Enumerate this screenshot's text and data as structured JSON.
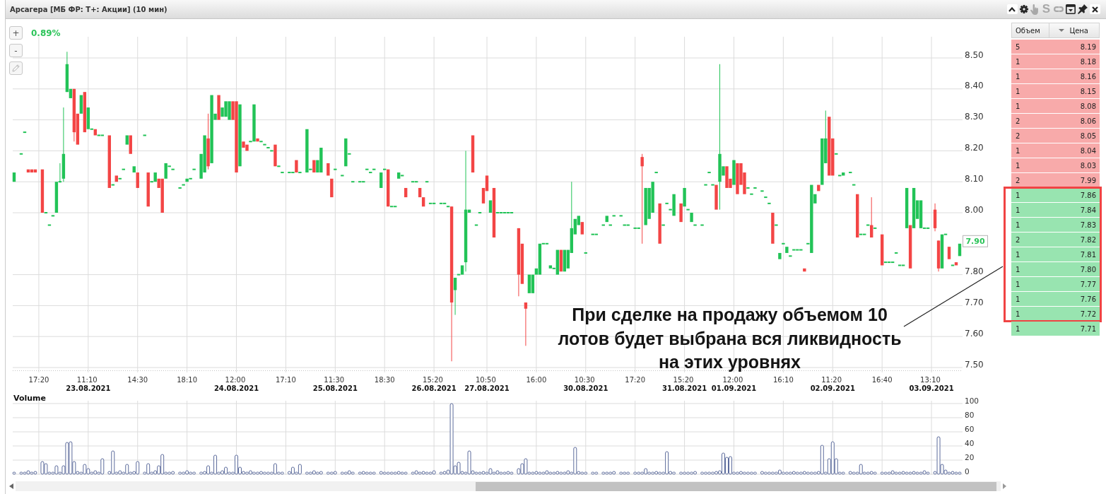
{
  "window": {
    "title": "Арсагера [МБ ФР: Т+: Акции] (10 мин)",
    "controls": [
      {
        "kind": "collapse",
        "disabled": false
      },
      {
        "kind": "settings",
        "disabled": false
      },
      {
        "kind": "hand",
        "disabled": true
      },
      {
        "kind": "letter",
        "label": "S",
        "disabled": true
      },
      {
        "kind": "link",
        "disabled": true
      },
      {
        "kind": "window",
        "disabled": false
      },
      {
        "kind": "pin",
        "disabled": false
      },
      {
        "kind": "close",
        "disabled": false
      }
    ]
  },
  "chart": {
    "tools": [
      {
        "kind": "zoom_in",
        "label": "+",
        "disabled": false
      },
      {
        "kind": "zoom_out",
        "label": "-",
        "disabled": false
      },
      {
        "kind": "pencil",
        "disabled": true
      }
    ],
    "change": "0.89%",
    "last_price": "7.90",
    "chart_data": {
      "type": "candlestick",
      "grid": true,
      "ylim": [
        7.5,
        8.5
      ],
      "yticks": [
        {
          "value": 8.5,
          "label": "8.50"
        },
        {
          "value": 8.4,
          "label": "8.40"
        },
        {
          "value": 8.3,
          "label": "8.30"
        },
        {
          "value": 8.2,
          "label": "8.20"
        },
        {
          "value": 8.1,
          "label": "8.10"
        },
        {
          "value": 8.0,
          "label": "8.00"
        },
        {
          "value": 7.8,
          "label": "7.80"
        },
        {
          "value": 7.7,
          "label": "7.70"
        },
        {
          "value": 7.6,
          "label": "7.60"
        },
        {
          "value": 7.5,
          "label": "7.50"
        }
      ],
      "categories": [
        null,
        null,
        null,
        null,
        null,
        null,
        null,
        "17:20",
        null,
        null,
        null,
        null,
        null,
        null,
        null,
        null,
        null,
        null,
        null,
        null,
        null,
        "11:10\n23.08.2021",
        null,
        null,
        null,
        null,
        null,
        null,
        null,
        null,
        null,
        null,
        null,
        null,
        null,
        "14:30",
        null,
        null,
        null,
        null,
        null,
        null,
        null,
        null,
        null,
        null,
        null,
        null,
        null,
        "18:10",
        null,
        null,
        null,
        null,
        null,
        null,
        null,
        null,
        null,
        null,
        null,
        null,
        null,
        "12:00\n24.08.2021",
        null,
        null,
        null,
        null,
        null,
        null,
        null,
        null,
        null,
        null,
        null,
        null,
        null,
        "17:10",
        null,
        null,
        null,
        null,
        null,
        null,
        null,
        null,
        null,
        null,
        null,
        null,
        null,
        "11:30\n25.08.2021",
        null,
        null,
        null,
        null,
        null,
        null,
        null,
        null,
        null,
        null,
        null,
        null,
        null,
        "18:30",
        null,
        null,
        null,
        null,
        null,
        null,
        null,
        null,
        null,
        null,
        null,
        null,
        null,
        "15:20\n26.08.2021",
        null,
        null,
        null,
        null,
        null,
        null,
        null,
        null,
        null,
        null,
        null,
        null,
        null,
        null,
        "10:50\n27.08.2021",
        null,
        null,
        null,
        null,
        null,
        null,
        null,
        null,
        null,
        null,
        null,
        null,
        null,
        "16:00",
        null,
        null,
        null,
        null,
        null,
        null,
        null,
        null,
        null,
        null,
        null,
        null,
        null,
        "10:30\n30.08.2021",
        null,
        null,
        null,
        null,
        null,
        null,
        null,
        null,
        null,
        null,
        null,
        null,
        null,
        "17:20",
        null,
        null,
        null,
        null,
        null,
        null,
        null,
        null,
        null,
        null,
        null,
        null,
        null,
        "15:20\n31.08.2021",
        null,
        null,
        null,
        null,
        null,
        null,
        null,
        null,
        null,
        null,
        null,
        null,
        null,
        "12:00\n01.09.2021",
        null,
        null,
        null,
        null,
        null,
        null,
        null,
        null,
        null,
        null,
        null,
        null,
        null,
        "16:10",
        null,
        null,
        null,
        null,
        null,
        null,
        null,
        null,
        null,
        null,
        null,
        null,
        null,
        "11:20\n02.09.2021",
        null,
        null,
        null,
        null,
        null,
        null,
        null,
        null,
        null,
        null,
        null,
        null,
        null,
        "16:40",
        null,
        null,
        null,
        null,
        null,
        null,
        null,
        null,
        null,
        null,
        null,
        null,
        null,
        "13:10\n03.09.2021",
        null,
        null,
        null,
        null,
        null,
        null,
        null,
        null
      ],
      "ohlc": [
        [
          8.1,
          8.13,
          8.1,
          8.13
        ],
        null,
        [
          8.19,
          8.19,
          8.19,
          8.19
        ],
        [
          8.26,
          8.26,
          8.26,
          8.26
        ],
        [
          8.14,
          8.14,
          8.13,
          8.13
        ],
        [
          8.14,
          8.14,
          8.13,
          8.13
        ],
        [
          8.14,
          8.14,
          8.13,
          8.13
        ],
        null,
        [
          8.14,
          8.14,
          8.0,
          8.0
        ],
        [
          8.0,
          8.0,
          8.0,
          8.0
        ],
        [
          7.96,
          7.96,
          7.96,
          7.96
        ],
        [
          7.99,
          7.99,
          7.99,
          7.99
        ],
        [
          8.0,
          8.1,
          8.0,
          8.1
        ],
        [
          8.1,
          8.16,
          8.1,
          8.1
        ],
        [
          8.11,
          8.34,
          8.1,
          8.19
        ],
        [
          8.39,
          8.52,
          8.39,
          8.48
        ],
        [
          8.37,
          8.4,
          8.37,
          8.4
        ],
        [
          8.4,
          8.4,
          8.23,
          8.26
        ],
        [
          8.32,
          8.32,
          8.22,
          8.22
        ],
        [
          8.32,
          8.38,
          8.32,
          8.38
        ],
        [
          8.39,
          8.39,
          8.26,
          8.26
        ],
        [
          8.27,
          8.34,
          8.27,
          8.34
        ],
        [
          8.27,
          8.27,
          8.27,
          8.27
        ],
        [
          8.27,
          8.27,
          8.25,
          8.25
        ],
        [
          8.25,
          8.25,
          8.25,
          8.25
        ],
        [
          8.25,
          8.25,
          8.25,
          8.25
        ],
        null,
        [
          8.25,
          8.25,
          8.08,
          8.08
        ],
        [
          8.09,
          8.09,
          8.09,
          8.09
        ],
        [
          8.12,
          8.12,
          8.1,
          8.1
        ],
        [
          8.11,
          8.11,
          8.11,
          8.11
        ],
        [
          8.14,
          8.14,
          8.14,
          8.14
        ],
        [
          8.22,
          8.25,
          8.22,
          8.25
        ],
        [
          8.25,
          8.25,
          8.19,
          8.19
        ],
        [
          8.13,
          8.15,
          8.13,
          8.15
        ],
        [
          8.13,
          8.13,
          8.08,
          8.08
        ],
        null,
        [
          8.25,
          8.25,
          8.25,
          8.25
        ],
        [
          8.13,
          8.13,
          8.02,
          8.02
        ],
        [
          8.1,
          8.1,
          8.1,
          8.1
        ],
        [
          8.1,
          8.13,
          8.1,
          8.13
        ],
        [
          8.11,
          8.11,
          8.08,
          8.08
        ],
        [
          8.11,
          8.11,
          8.0,
          8.0
        ],
        [
          8.11,
          8.16,
          8.11,
          8.16
        ],
        [
          8.15,
          8.15,
          8.15,
          8.15
        ],
        [
          8.14,
          8.14,
          8.14,
          8.14
        ],
        null,
        [
          8.08,
          8.08,
          8.08,
          8.08
        ],
        [
          8.09,
          8.09,
          8.09,
          8.09
        ],
        [
          8.1,
          8.11,
          8.1,
          8.11
        ],
        [
          8.11,
          8.11,
          8.11,
          8.11
        ],
        [
          8.14,
          8.14,
          8.14,
          8.14
        ],
        null,
        [
          8.11,
          8.19,
          8.11,
          8.19
        ],
        [
          8.13,
          8.25,
          8.13,
          8.25
        ],
        [
          8.24,
          8.32,
          8.14,
          8.15
        ],
        [
          8.16,
          8.38,
          8.16,
          8.38
        ],
        [
          8.3,
          8.32,
          8.3,
          8.32
        ],
        [
          8.38,
          8.38,
          8.3,
          8.3
        ],
        [
          8.31,
          8.34,
          8.31,
          8.34
        ],
        [
          8.31,
          8.36,
          8.31,
          8.36
        ],
        [
          8.3,
          8.36,
          8.3,
          8.36
        ],
        [
          8.36,
          8.36,
          8.3,
          8.3
        ],
        [
          8.36,
          8.36,
          8.13,
          8.13
        ],
        [
          8.15,
          8.35,
          8.15,
          8.35
        ],
        [
          8.23,
          8.23,
          8.21,
          8.21
        ],
        [
          8.22,
          8.22,
          8.2,
          8.2
        ],
        [
          8.23,
          8.23,
          8.23,
          8.23
        ],
        [
          8.23,
          8.35,
          8.23,
          8.35
        ],
        [
          8.24,
          8.24,
          8.23,
          8.23
        ],
        [
          8.23,
          8.23,
          8.23,
          8.23
        ],
        [
          8.22,
          8.22,
          8.22,
          8.22
        ],
        [
          8.21,
          8.21,
          8.21,
          8.21
        ],
        [
          8.2,
          8.2,
          8.2,
          8.2
        ],
        [
          8.22,
          8.22,
          8.15,
          8.15
        ],
        [
          8.15,
          8.15,
          8.15,
          8.15
        ],
        [
          8.13,
          8.13,
          8.13,
          8.13
        ],
        null,
        [
          8.13,
          8.13,
          8.13,
          8.13
        ],
        [
          8.13,
          8.13,
          8.13,
          8.13
        ],
        [
          8.17,
          8.17,
          8.13,
          8.13
        ],
        [
          8.13,
          8.13,
          8.13,
          8.13
        ],
        null,
        [
          8.13,
          8.27,
          8.13,
          8.27
        ],
        [
          8.14,
          8.14,
          8.14,
          8.14
        ],
        [
          8.17,
          8.17,
          8.13,
          8.13
        ],
        [
          8.13,
          8.17,
          8.13,
          8.17
        ],
        [
          8.13,
          8.21,
          8.13,
          8.21
        ],
        null,
        [
          8.16,
          8.16,
          8.12,
          8.12
        ],
        [
          8.11,
          8.11,
          8.05,
          8.05
        ],
        [
          8.14,
          8.14,
          8.14,
          8.14
        ],
        null,
        [
          8.12,
          8.12,
          8.12,
          8.12
        ],
        [
          8.15,
          8.24,
          8.15,
          8.24
        ],
        [
          8.19,
          8.19,
          8.19,
          8.19
        ],
        [
          8.1,
          8.1,
          8.1,
          8.1
        ],
        null,
        [
          8.1,
          8.1,
          8.1,
          8.1
        ],
        [
          8.1,
          8.1,
          8.1,
          8.1
        ],
        [
          8.14,
          8.14,
          8.14,
          8.14
        ],
        [
          8.13,
          8.13,
          8.13,
          8.13
        ],
        [
          8.14,
          8.14,
          8.14,
          8.14
        ],
        null,
        [
          8.08,
          8.13,
          8.08,
          8.13
        ],
        [
          8.14,
          8.14,
          8.14,
          8.14
        ],
        [
          8.14,
          8.14,
          8.02,
          8.02
        ],
        [
          8.02,
          8.02,
          8.02,
          8.02
        ],
        [
          8.02,
          8.02,
          8.02,
          8.02
        ],
        [
          8.11,
          8.13,
          8.11,
          8.13
        ],
        [
          8.12,
          8.12,
          8.12,
          8.12
        ],
        [
          8.08,
          8.08,
          8.05,
          8.05
        ],
        null,
        [
          8.1,
          8.1,
          8.1,
          8.1
        ],
        [
          8.1,
          8.1,
          8.1,
          8.1
        ],
        [
          8.08,
          8.08,
          8.05,
          8.05
        ],
        [
          8.05,
          8.05,
          8.02,
          8.02
        ],
        [
          8.1,
          8.1,
          8.1,
          8.1
        ],
        [
          8.03,
          8.03,
          8.03,
          8.03
        ],
        [
          8.03,
          8.03,
          8.03,
          8.03
        ],
        null,
        [
          8.03,
          8.03,
          8.03,
          8.03
        ],
        [
          8.03,
          8.03,
          8.03,
          8.03
        ],
        [
          8.02,
          8.02,
          8.02,
          8.02
        ],
        [
          8.02,
          8.02,
          7.52,
          7.71
        ],
        [
          7.75,
          7.79,
          7.67,
          7.79
        ],
        [
          7.8,
          7.8,
          7.8,
          7.8
        ],
        [
          7.8,
          7.83,
          7.8,
          7.83
        ],
        [
          7.84,
          8.2,
          7.81,
          8.01
        ],
        [
          8.0,
          8.01,
          8.0,
          8.01
        ],
        [
          8.25,
          8.25,
          8.13,
          8.13
        ],
        [
          7.96,
          7.96,
          7.96,
          7.96
        ],
        [
          8.0,
          8.0,
          8.0,
          8.0
        ],
        [
          8.08,
          8.08,
          8.03,
          8.03
        ],
        [
          8.12,
          8.12,
          8.07,
          8.07
        ],
        [
          8.0,
          8.04,
          8.0,
          8.04
        ],
        [
          8.08,
          8.08,
          7.92,
          7.92
        ],
        [
          8.0,
          8.0,
          8.0,
          8.0
        ],
        [
          8.0,
          8.0,
          8.0,
          8.0
        ],
        [
          8.0,
          8.0,
          8.0,
          8.0
        ],
        [
          8.0,
          8.0,
          8.0,
          8.0
        ],
        [
          8.0,
          8.0,
          8.0,
          8.0
        ],
        null,
        [
          7.95,
          7.95,
          7.73,
          7.8
        ],
        [
          7.9,
          7.9,
          7.77,
          7.77
        ],
        [
          7.71,
          7.71,
          7.57,
          7.69
        ],
        [
          7.74,
          7.8,
          7.74,
          7.8
        ],
        [
          7.74,
          7.8,
          7.74,
          7.8
        ],
        [
          7.8,
          7.82,
          7.8,
          7.82
        ],
        [
          7.8,
          7.9,
          7.8,
          7.9
        ],
        [
          7.9,
          7.9,
          7.9,
          7.9
        ],
        [
          7.9,
          7.9,
          7.9,
          7.9
        ],
        [
          7.82,
          7.83,
          7.82,
          7.83
        ],
        [
          7.82,
          7.82,
          7.82,
          7.82
        ],
        [
          7.8,
          7.88,
          7.8,
          7.88
        ],
        [
          7.88,
          7.88,
          7.81,
          7.81
        ],
        [
          7.81,
          7.88,
          7.81,
          7.88
        ],
        [
          7.82,
          7.88,
          7.82,
          7.88
        ],
        [
          7.87,
          8.1,
          7.87,
          7.95
        ],
        [
          7.93,
          7.98,
          7.93,
          7.98
        ],
        [
          7.96,
          7.99,
          7.96,
          7.99
        ],
        [
          7.97,
          7.97,
          7.93,
          7.93
        ],
        [
          7.87,
          7.87,
          7.87,
          7.87
        ],
        null,
        [
          7.93,
          7.93,
          7.93,
          7.93
        ],
        [
          7.93,
          7.93,
          7.93,
          7.93
        ],
        null,
        [
          7.96,
          7.96,
          7.96,
          7.96
        ],
        [
          7.97,
          7.99,
          7.97,
          7.99
        ],
        [
          7.96,
          7.96,
          7.96,
          7.96
        ],
        [
          7.99,
          7.99,
          7.99,
          7.99
        ],
        null,
        [
          7.99,
          7.99,
          7.99,
          7.99
        ],
        [
          7.96,
          7.96,
          7.96,
          7.96
        ],
        [
          7.96,
          7.96,
          7.96,
          7.96
        ],
        null,
        [
          7.95,
          7.95,
          7.95,
          7.95
        ],
        [
          7.95,
          7.95,
          7.95,
          7.95
        ],
        [
          8.18,
          8.19,
          7.9,
          8.15
        ],
        [
          7.96,
          8.08,
          7.96,
          8.08
        ],
        [
          7.98,
          8.08,
          7.98,
          8.08
        ],
        [
          8.0,
          8.1,
          8.0,
          8.1
        ],
        [
          8.13,
          8.13,
          8.13,
          8.13
        ],
        [
          8.03,
          8.03,
          7.9,
          7.9
        ],
        [
          7.96,
          7.96,
          7.96,
          7.96
        ],
        [
          8.03,
          8.03,
          8.03,
          8.03
        ],
        [
          8.01,
          8.01,
          8.01,
          8.01
        ],
        [
          7.99,
          8.06,
          7.99,
          8.06
        ],
        null,
        [
          8.03,
          8.03,
          7.97,
          7.97
        ],
        [
          8.02,
          8.08,
          8.02,
          8.08
        ],
        [
          8.01,
          8.01,
          8.01,
          8.01
        ],
        [
          7.97,
          8.0,
          7.97,
          8.0
        ],
        [
          7.96,
          7.96,
          7.96,
          7.96
        ],
        null,
        [
          7.96,
          7.96,
          7.96,
          7.96
        ],
        [
          8.09,
          8.09,
          8.09,
          8.09
        ],
        [
          8.13,
          8.13,
          8.13,
          8.13
        ],
        [
          8.09,
          8.09,
          8.09,
          8.09
        ],
        [
          8.09,
          8.09,
          8.01,
          8.01
        ],
        [
          8.1,
          8.48,
          8.01,
          8.19
        ],
        [
          8.12,
          8.15,
          8.12,
          8.15
        ],
        [
          8.15,
          8.15,
          8.08,
          8.08
        ],
        [
          8.11,
          8.11,
          8.08,
          8.08
        ],
        [
          8.09,
          8.17,
          8.09,
          8.17
        ],
        [
          8.16,
          8.16,
          8.06,
          8.06
        ],
        [
          8.16,
          8.16,
          8.09,
          8.09
        ],
        [
          8.13,
          8.13,
          8.06,
          8.06
        ],
        [
          8.08,
          8.08,
          8.08,
          8.08
        ],
        [
          8.06,
          8.06,
          8.06,
          8.06
        ],
        [
          8.08,
          8.08,
          8.08,
          8.08
        ],
        null,
        [
          8.07,
          8.07,
          8.07,
          8.07
        ],
        [
          8.05,
          8.05,
          8.05,
          8.05
        ],
        [
          8.03,
          8.03,
          8.03,
          8.03
        ],
        [
          8.0,
          8.0,
          7.9,
          7.9
        ],
        [
          7.96,
          7.96,
          7.96,
          7.96
        ],
        [
          7.85,
          7.87,
          7.85,
          7.87
        ],
        [
          7.9,
          7.9,
          7.9,
          7.9
        ],
        [
          7.87,
          7.89,
          7.87,
          7.89
        ],
        [
          7.86,
          7.86,
          7.86,
          7.86
        ],
        [
          7.88,
          7.88,
          7.88,
          7.88
        ],
        [
          7.88,
          7.88,
          7.88,
          7.88
        ],
        [
          7.88,
          7.88,
          7.88,
          7.88
        ],
        [
          7.82,
          7.82,
          7.81,
          7.81
        ],
        [
          7.9,
          7.9,
          7.9,
          7.9
        ],
        [
          7.87,
          8.09,
          7.87,
          8.09
        ],
        [
          8.03,
          8.06,
          8.03,
          8.06
        ],
        [
          8.09,
          8.09,
          8.07,
          8.07
        ],
        [
          8.09,
          8.24,
          8.09,
          8.24
        ],
        [
          8.16,
          8.33,
          8.16,
          8.24
        ],
        [
          8.31,
          8.31,
          8.12,
          8.12
        ],
        [
          8.24,
          8.24,
          8.12,
          8.12
        ],
        [
          8.19,
          8.19,
          8.19,
          8.19
        ],
        [
          8.12,
          8.12,
          8.12,
          8.12
        ],
        [
          8.12,
          8.13,
          8.12,
          8.13
        ],
        null,
        [
          8.13,
          8.13,
          8.13,
          8.13
        ],
        [
          8.09,
          8.09,
          8.09,
          8.09
        ],
        [
          8.06,
          8.06,
          7.92,
          7.92
        ],
        [
          7.93,
          7.93,
          7.93,
          7.93
        ],
        [
          7.93,
          7.93,
          7.93,
          7.93
        ],
        [
          7.96,
          7.96,
          7.96,
          7.96
        ],
        [
          7.96,
          8.05,
          7.92,
          7.92
        ],
        [
          7.95,
          7.95,
          7.95,
          7.95
        ],
        null,
        [
          7.93,
          7.93,
          7.83,
          7.83
        ],
        [
          7.84,
          7.84,
          7.84,
          7.84
        ],
        [
          7.84,
          7.84,
          7.84,
          7.84
        ],
        [
          7.84,
          7.84,
          7.84,
          7.84
        ],
        [
          7.87,
          7.87,
          7.87,
          7.87
        ],
        [
          7.83,
          7.83,
          7.83,
          7.83
        ],
        [
          7.83,
          7.83,
          7.83,
          7.83
        ],
        [
          7.95,
          8.08,
          7.95,
          8.08
        ],
        [
          7.96,
          7.96,
          7.82,
          7.82
        ],
        [
          7.95,
          8.08,
          7.95,
          8.08
        ],
        [
          7.98,
          8.04,
          7.98,
          8.04
        ],
        [
          7.95,
          8.04,
          7.95,
          8.04
        ],
        [
          7.95,
          7.95,
          7.95,
          7.95
        ],
        [
          7.95,
          7.95,
          7.95,
          7.95
        ],
        null,
        [
          8.01,
          8.03,
          7.94,
          7.95
        ],
        [
          7.91,
          7.91,
          7.81,
          7.82
        ],
        [
          7.82,
          7.93,
          7.82,
          7.93
        ],
        [
          7.93,
          7.93,
          7.93,
          7.93
        ],
        [
          7.89,
          7.89,
          7.85,
          7.85
        ],
        [
          7.83,
          7.83,
          7.83,
          7.83
        ],
        [
          7.84,
          7.84,
          7.83,
          7.83
        ],
        [
          7.86,
          7.9,
          7.86,
          7.9
        ]
      ]
    }
  },
  "volume": {
    "chart_data": {
      "type": "bar",
      "grid": true,
      "title": "Volume",
      "ylim": [
        0,
        100
      ],
      "yticks": [
        {
          "value": 100,
          "label": "100"
        },
        {
          "value": 80,
          "label": "80"
        },
        {
          "value": 60,
          "label": "60"
        },
        {
          "value": 40,
          "label": "40"
        },
        {
          "value": 20,
          "label": "20"
        },
        {
          "value": 0,
          "label": "0"
        }
      ],
      "categories": [
        null,
        null,
        null,
        null,
        null,
        null,
        null,
        null,
        null,
        null,
        null,
        null,
        null,
        null,
        null,
        null,
        null,
        null,
        null,
        null,
        null,
        null,
        null,
        null,
        null,
        null,
        null,
        null,
        null,
        null,
        null,
        null,
        null,
        null,
        null,
        null,
        null,
        null,
        null,
        null,
        null,
        null,
        null,
        null,
        null,
        null,
        null,
        null,
        null,
        null,
        null,
        null,
        null,
        null,
        null,
        null,
        null,
        null,
        null,
        null,
        null,
        null,
        null,
        null,
        null,
        null,
        null,
        null,
        null,
        null,
        null,
        null,
        null,
        null,
        null,
        null,
        null,
        null,
        null,
        null,
        null,
        null,
        null,
        null,
        null,
        null,
        null,
        null,
        null,
        null,
        null,
        null,
        null,
        null,
        null,
        null,
        null,
        null,
        null,
        null,
        null,
        null,
        null,
        null,
        null,
        null,
        null,
        null,
        null,
        null,
        null,
        null,
        null,
        null,
        null,
        null,
        null,
        null,
        null,
        null,
        null,
        null,
        null,
        null,
        null,
        null,
        null,
        null,
        null,
        null,
        null,
        null,
        null,
        null,
        null,
        null,
        null,
        null,
        null,
        null,
        null,
        null,
        null,
        null,
        null,
        null,
        null,
        null,
        null,
        null,
        null,
        null,
        null,
        null,
        null,
        null,
        null,
        null,
        null,
        null,
        null,
        null,
        null,
        null,
        null,
        null,
        null,
        null,
        null,
        null,
        null,
        null,
        null,
        null,
        null,
        null,
        null,
        null,
        null,
        null,
        null,
        null,
        null,
        null,
        null,
        null,
        null,
        null,
        null,
        null,
        null,
        null,
        null,
        null,
        null,
        null,
        null,
        null,
        null,
        null,
        null,
        null,
        null,
        null,
        null,
        null,
        null,
        null,
        null,
        null,
        null,
        null,
        null,
        null,
        null,
        null,
        null,
        null,
        null,
        null,
        null,
        null,
        null,
        null,
        null,
        null,
        null,
        null,
        null,
        null,
        null,
        null,
        null,
        null,
        null,
        null,
        null,
        null,
        null,
        null,
        null,
        null,
        null,
        null,
        null,
        null,
        null,
        null,
        null,
        null,
        null,
        null,
        null,
        null,
        null,
        null,
        null,
        null,
        null,
        null,
        null,
        null,
        null,
        null,
        null,
        null,
        null,
        null,
        null
      ],
      "values": [
        2,
        null,
        1,
        3,
        5,
        2,
        4,
        null,
        18,
        15,
        2,
        3,
        12,
        2,
        12,
        45,
        46,
        18,
        4,
        2,
        14,
        8,
        3,
        5,
        2,
        22,
        null,
        4,
        33,
        2,
        5,
        3,
        14,
        2,
        4,
        18,
        null,
        3,
        15,
        2,
        5,
        12,
        28,
        3,
        2,
        4,
        null,
        1,
        3,
        5,
        2,
        2,
        null,
        3,
        4,
        12,
        2,
        27,
        3,
        5,
        10,
        2,
        3,
        27,
        10,
        4,
        2,
        5,
        3,
        2,
        4,
        1,
        3,
        2,
        15,
        3,
        2,
        null,
        4,
        10,
        3,
        14,
        null,
        2,
        3,
        5,
        2,
        4,
        null,
        3,
        2,
        4,
        null,
        3,
        2,
        5,
        3,
        null,
        2,
        4,
        2,
        3,
        2,
        null,
        4,
        2,
        3,
        2,
        2,
        4,
        3,
        2,
        null,
        3,
        5,
        2,
        4,
        3,
        2,
        5,
        null,
        3,
        4,
        6,
        100,
        12,
        17,
        4,
        3,
        33,
        5,
        2,
        3,
        4,
        2,
        8,
        3,
        5,
        2,
        3,
        4,
        2,
        null,
        8,
        15,
        22,
        3,
        2,
        4,
        3,
        2,
        5,
        3,
        2,
        4,
        3,
        2,
        5,
        3,
        38,
        4,
        2,
        3,
        null,
        2,
        2,
        null,
        3,
        2,
        2,
        4,
        null,
        2,
        3,
        2,
        null,
        2,
        3,
        2,
        8,
        3,
        2,
        4,
        3,
        2,
        32,
        4,
        2,
        null,
        3,
        2,
        3,
        2,
        4,
        null,
        2,
        3,
        2,
        3,
        4,
        5,
        30,
        24,
        25,
        3,
        2,
        4,
        3,
        2,
        3,
        2,
        null,
        4,
        2,
        3,
        2,
        3,
        6,
        2,
        3,
        2,
        4,
        2,
        3,
        4,
        2,
        3,
        2,
        4,
        41,
        3,
        22,
        46,
        22,
        3,
        2,
        null,
        4,
        3,
        2,
        14,
        3,
        2,
        4,
        3,
        null,
        2,
        3,
        2,
        5,
        3,
        2,
        4,
        3,
        2,
        4,
        3,
        2,
        5,
        3,
        null,
        4,
        53,
        14,
        6,
        3,
        4,
        2,
        3
      ]
    }
  },
  "order_book": {
    "columns": [
      {
        "label": "Объем",
        "sorted": false
      },
      {
        "label": "Цена",
        "sorted": true
      }
    ],
    "sections": [
      {
        "highlighted": false,
        "rows": [
          {
            "volume": "5",
            "price": "8.19",
            "kind": "sell"
          },
          {
            "volume": "1",
            "price": "8.18",
            "kind": "sell"
          },
          {
            "volume": "1",
            "price": "8.16",
            "kind": "sell"
          },
          {
            "volume": "1",
            "price": "8.15",
            "kind": "sell"
          },
          {
            "volume": "1",
            "price": "8.08",
            "kind": "sell"
          },
          {
            "volume": "2",
            "price": "8.06",
            "kind": "sell"
          },
          {
            "volume": "2",
            "price": "8.05",
            "kind": "sell"
          },
          {
            "volume": "1",
            "price": "8.04",
            "kind": "sell"
          },
          {
            "volume": "1",
            "price": "8.03",
            "kind": "sell"
          },
          {
            "volume": "2",
            "price": "7.99",
            "kind": "sell"
          }
        ]
      },
      {
        "highlighted": true,
        "rows": [
          {
            "volume": "1",
            "price": "7.86",
            "kind": "buy"
          },
          {
            "volume": "1",
            "price": "7.84",
            "kind": "buy"
          },
          {
            "volume": "1",
            "price": "7.83",
            "kind": "buy"
          },
          {
            "volume": "2",
            "price": "7.82",
            "kind": "buy"
          },
          {
            "volume": "1",
            "price": "7.81",
            "kind": "buy"
          },
          {
            "volume": "1",
            "price": "7.80",
            "kind": "buy"
          },
          {
            "volume": "1",
            "price": "7.77",
            "kind": "buy"
          },
          {
            "volume": "1",
            "price": "7.76",
            "kind": "buy"
          },
          {
            "volume": "1",
            "price": "7.72",
            "kind": "buy"
          }
        ]
      },
      {
        "highlighted": false,
        "rows": [
          {
            "volume": "1",
            "price": "7.71",
            "kind": "buy"
          }
        ]
      }
    ]
  },
  "annotation": {
    "text": "При сделке на продажу объемом 10 лотов будет выбрана вся ликвидность на этих уровнях"
  }
}
